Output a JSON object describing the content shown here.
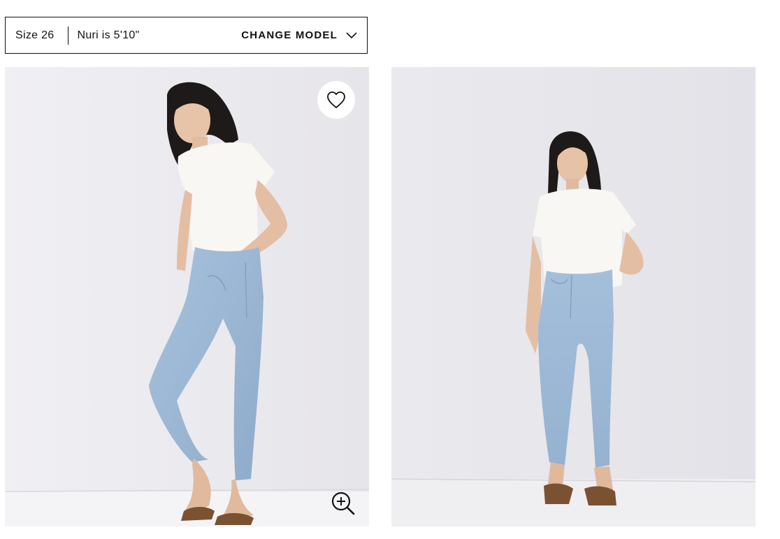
{
  "model_selector": {
    "size_label": "Size 26",
    "model_height": "Nuri is 5'10\"",
    "change_model_label": "CHANGE MODEL",
    "chevron_icon": "chevron-down-icon"
  },
  "gallery": {
    "images": [
      {
        "name": "product-image-front-angled",
        "alt": "Model in white tee and light wash skinny jeans, leaning pose"
      },
      {
        "name": "product-image-front-straight",
        "alt": "Model in white tee and light wash skinny jeans, standing pose"
      }
    ],
    "favorite_icon": "heart-icon",
    "zoom_icon": "zoom-in-icon"
  },
  "colors": {
    "text": "#111111",
    "backdrop": "#ecebef",
    "denim": "#9fbcd8",
    "tee": "#f7f6f3"
  }
}
